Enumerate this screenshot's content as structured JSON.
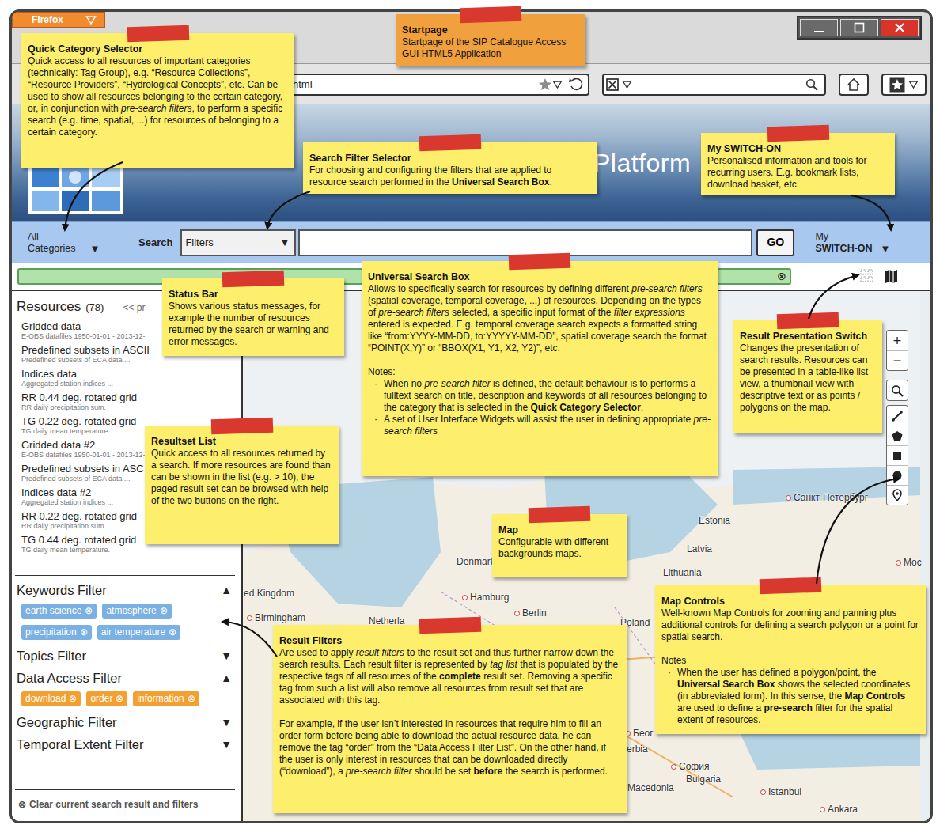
{
  "window": {
    "title": "Firefox"
  },
  "browser": {
    "url": "html"
  },
  "header": {
    "title": "Platform"
  },
  "toolbar": {
    "category_lines": [
      "All",
      "Categories"
    ],
    "category_arrow": "▼",
    "search_label": "Search",
    "filter_select": "Filters",
    "filter_arrow": "▼",
    "go": "GO",
    "account_lines": [
      "My",
      "SWITCH-ON"
    ],
    "account_arrow": "▼"
  },
  "status_bar": {
    "clear": "⊗"
  },
  "views": [
    {
      "kind": "thumbnails",
      "selected": false
    },
    {
      "kind": "map",
      "selected": true
    }
  ],
  "resources": {
    "title": "Resources",
    "count": "(78)",
    "pager": "<< pr",
    "items": [
      {
        "title": "Gridded data",
        "subtitle": "E-OBS datafiles 1950-01-01 - 2013-12-"
      },
      {
        "title": "Predefined subsets in ASCII",
        "subtitle": "Predefined subsets of ECA data ..."
      },
      {
        "title": "Indices data",
        "subtitle": "Aggregated station indices ..."
      },
      {
        "title": "RR 0.44 deg. rotated grid",
        "subtitle": "RR daily precipitation sum."
      },
      {
        "title": "TG 0.22 deg. rotated grid",
        "subtitle": "TG daily mean temperature."
      },
      {
        "title": "Gridded data #2",
        "subtitle": "E-OBS datafiles 1950-01-01 - 2013-12-"
      },
      {
        "title": "Predefined subsets in ASC",
        "subtitle": "Predefined subsets of ECA data ..."
      },
      {
        "title": "Indices data #2",
        "subtitle": "Aggregated station indices ..."
      },
      {
        "title": "RR 0.22 deg. rotated grid",
        "subtitle": "RR daily precipitation sum."
      },
      {
        "title": "TG 0.44 deg. rotated grid",
        "subtitle": "TG daily mean temperature."
      }
    ]
  },
  "filters": {
    "remove": "⊗",
    "groups": [
      {
        "title": "Keywords Filter",
        "expanded": true,
        "arrow": "▲",
        "tags": [
          {
            "label": "earth science",
            "color": "#7bb0e3"
          },
          {
            "label": "atmosphere",
            "color": "#7bb0e3"
          },
          {
            "label": "precipitation",
            "color": "#7bb0e3"
          },
          {
            "label": "air temperature",
            "color": "#7bb0e3"
          }
        ]
      },
      {
        "title": "Topics Filter",
        "expanded": false,
        "arrow": "▼",
        "tags": []
      },
      {
        "title": "Data Access Filter",
        "expanded": true,
        "arrow": "▲",
        "tags": [
          {
            "label": "download",
            "color": "#f3a030"
          },
          {
            "label": "order",
            "color": "#f3a030"
          },
          {
            "label": "information",
            "color": "#f3a030"
          }
        ]
      },
      {
        "title": "Geographic Filter",
        "expanded": false,
        "arrow": "▼",
        "tags": []
      },
      {
        "title": "Temporal Extent Filter",
        "expanded": false,
        "arrow": "▼",
        "tags": []
      }
    ],
    "clear_icon": "⊗",
    "clear": "Clear current search result and filters"
  },
  "map": {
    "zoom_in": "+",
    "zoom_out": "−",
    "tools": [
      {
        "kind": "search"
      },
      {
        "kind": "line"
      },
      {
        "kind": "polygon"
      },
      {
        "kind": "rectangle"
      },
      {
        "kind": "circle"
      },
      {
        "kind": "point"
      }
    ],
    "labels": [
      {
        "text": "Санкт-Петербург",
        "kind": "city"
      },
      {
        "text": "Moc",
        "kind": "city"
      },
      {
        "text": "Estonia",
        "kind": "country"
      },
      {
        "text": "Latvia",
        "kind": "country"
      },
      {
        "text": "Lithuania",
        "kind": "country"
      },
      {
        "text": "Denmark",
        "kind": "country"
      },
      {
        "text": "Hamburg",
        "kind": "city"
      },
      {
        "text": "Berlin",
        "kind": "city"
      },
      {
        "text": "Poland",
        "kind": "country"
      },
      {
        "text": "Netherla",
        "kind": "country"
      },
      {
        "text": "ed Kingdom",
        "kind": "country"
      },
      {
        "text": "Birmingham",
        "kind": "city"
      },
      {
        "text": "Беог",
        "kind": "city"
      },
      {
        "text": "erbia",
        "kind": "country"
      },
      {
        "text": "София",
        "kind": "city"
      },
      {
        "text": "Bulgaria",
        "kind": "country"
      },
      {
        "text": "Macedonia",
        "kind": "country"
      },
      {
        "text": "Istanbul",
        "kind": "city"
      },
      {
        "text": "Ankara",
        "kind": "city"
      }
    ]
  },
  "notes": [
    {
      "title": "Quick Category Selector",
      "color": "#fdef6b",
      "paragraphs": [
        {
          "kind": "text",
          "runs": [
            {
              "text": "Quick access to all resources of important categories (technically: Tag Group), e.g. “Resource Collections”, “Resource Providers”, “Hydrological Concepts”, etc. Can be used to show all resources belonging to the certain category, or, in conjunction with ",
              "kind": "plain"
            },
            {
              "text": "pre-search filters",
              "kind": "italic"
            },
            {
              "text": ", to perform a specific search (e.g. time, spatial, ...) for resources of belonging to a certain category.",
              "kind": "plain"
            }
          ]
        }
      ]
    },
    {
      "title": "Startpage",
      "color": "#f0a03c",
      "paragraphs": [
        {
          "kind": "text",
          "runs": [
            {
              "text": "Startpage of the SIP Catalogue Access GUI HTML5 Application",
              "kind": "plain"
            }
          ]
        }
      ]
    },
    {
      "title": "Search Filter Selector",
      "color": "#fdef6b",
      "paragraphs": [
        {
          "kind": "text",
          "runs": [
            {
              "text": "For choosing and configuring the filters  that are applied to resource search performed in  the ",
              "kind": "plain"
            },
            {
              "text": "Universal Search Box",
              "kind": "bold"
            },
            {
              "text": ".",
              "kind": "plain"
            }
          ]
        }
      ]
    },
    {
      "title": "My SWITCH-ON",
      "color": "#fdef6b",
      "paragraphs": [
        {
          "kind": "text",
          "runs": [
            {
              "text": "Personalised information and tools for recurring users. E.g. bookmark lists, download basket, etc.",
              "kind": "plain"
            }
          ]
        }
      ]
    },
    {
      "title": "Status Bar",
      "color": "#fdef6b",
      "paragraphs": [
        {
          "kind": "text",
          "runs": [
            {
              "text": "Shows various status messages, for example the number of resources returned by the search or warning and error messages.",
              "kind": "plain"
            }
          ]
        }
      ]
    },
    {
      "title": "Universal Search Box",
      "color": "#fdef6b",
      "paragraphs": [
        {
          "kind": "text",
          "runs": [
            {
              "text": "Allows to specifically search for resources by defining different ",
              "kind": "plain"
            },
            {
              "text": "pre-search filters",
              "kind": "italic"
            },
            {
              "text": " (spatial coverage, temporal coverage, ...) of resources. Depending on the types of ",
              "kind": "plain"
            },
            {
              "text": "pre-search filters",
              "kind": "italic"
            },
            {
              "text": " selected, a specific input format of the ",
              "kind": "plain"
            },
            {
              "text": "filter expressions",
              "kind": "italic"
            },
            {
              "text": " entered is expected. E.g. temporal coverage search expects a formatted string like “from:YYYY-MM-DD, to:YYYYY-MM-DD”, spatial coverage search the format “POINT(X,Y)” or “BBOX(X1, Y1, X2, Y2)”, etc.",
              "kind": "plain"
            }
          ]
        },
        {
          "kind": "heading",
          "runs": [
            {
              "text": "Notes:",
              "kind": "plain"
            }
          ]
        },
        {
          "kind": "bullet",
          "marker": "·",
          "runs": [
            {
              "text": "When no ",
              "kind": "plain"
            },
            {
              "text": "pre-search filter",
              "kind": "italic"
            },
            {
              "text": " is defined, the default behaviour is to performs a fulltext search on title, description and keywords of all resources belonging to the category that is selected in the ",
              "kind": "plain"
            },
            {
              "text": "Quick Category Selector",
              "kind": "bold"
            },
            {
              "text": ".",
              "kind": "plain"
            }
          ]
        },
        {
          "kind": "bullet",
          "marker": "·",
          "runs": [
            {
              "text": "A set of User Interface Widgets will assist the user in defining appropriate ",
              "kind": "plain"
            },
            {
              "text": "pre-search filters",
              "kind": "italic"
            }
          ]
        }
      ]
    },
    {
      "title": "Result Presentation Switch",
      "color": "#fdef6b",
      "paragraphs": [
        {
          "kind": "text",
          "runs": [
            {
              "text": "Changes the presentation of search results. Resources can be presented in a table-like list view, a thumbnail view with descriptive text or as points / polygons on the map.",
              "kind": "plain"
            }
          ]
        }
      ]
    },
    {
      "title": "Resultset List",
      "color": "#fdef6b",
      "paragraphs": [
        {
          "kind": "text",
          "runs": [
            {
              "text": "Quick access to all resources returned by a search. If more resources are found than can be shown in the list (e.g. > 10), the paged result set can be browsed with help of the two buttons on the right.",
              "kind": "plain"
            }
          ]
        }
      ]
    },
    {
      "title": "Map",
      "color": "#fdef6b",
      "paragraphs": [
        {
          "kind": "text",
          "runs": [
            {
              "text": "Configurable with different backgrounds maps.",
              "kind": "plain"
            }
          ]
        }
      ]
    },
    {
      "title": "Map Controls",
      "color": "#fdef6b",
      "paragraphs": [
        {
          "kind": "text",
          "runs": [
            {
              "text": "Well-known Map Controls for zooming and panning plus additional controls for defining a search polygon or a point for spatial search.",
              "kind": "plain"
            }
          ]
        },
        {
          "kind": "heading",
          "runs": [
            {
              "text": "Notes",
              "kind": "plain"
            }
          ]
        },
        {
          "kind": "bullet",
          "marker": "·",
          "runs": [
            {
              "text": "When the user has defined a polygon/point, the ",
              "kind": "plain"
            },
            {
              "text": "Universal Search Box",
              "kind": "bold"
            },
            {
              "text": " shows the selected coordinates (in abbreviated form). In this sense, the ",
              "kind": "plain"
            },
            {
              "text": "Map Controls",
              "kind": "bold"
            },
            {
              "text": " are used to define a ",
              "kind": "plain"
            },
            {
              "text": "pre-search",
              "kind": "bold"
            },
            {
              "text": " filter for the spatial extent of resources.",
              "kind": "plain"
            }
          ]
        }
      ]
    },
    {
      "title": "Result Filters",
      "color": "#fdef6b",
      "paragraphs": [
        {
          "kind": "text",
          "runs": [
            {
              "text": "Are used to apply ",
              "kind": "plain"
            },
            {
              "text": "result filters",
              "kind": "italic"
            },
            {
              "text": " to the result set and thus further narrow down the search results. Each result filter is represented by ",
              "kind": "plain"
            },
            {
              "text": "tag list",
              "kind": "italic"
            },
            {
              "text": " that is populated by the respective tags of all resources of the ",
              "kind": "plain"
            },
            {
              "text": "complete",
              "kind": "bold"
            },
            {
              "text": " result set. Removing a specific tag from such a list will also remove all resources from result set that are associated with this tag.",
              "kind": "plain"
            }
          ]
        },
        {
          "kind": "text",
          "runs": [
            {
              "text": "For example, if the user isn’t interested in resources that require him to fill an order form before being able to download the actual resource data, he can remove the tag “order” from the “Data Access Filter List”. On the other hand, if the user is only interest in resources that can be downloaded directly (“download”), a ",
              "kind": "plain"
            },
            {
              "text": "pre-search filter",
              "kind": "italic"
            },
            {
              "text": " should be set ",
              "kind": "plain"
            },
            {
              "text": "before",
              "kind": "bold"
            },
            {
              "text": " the search is performed.",
              "kind": "plain"
            }
          ]
        }
      ]
    }
  ]
}
